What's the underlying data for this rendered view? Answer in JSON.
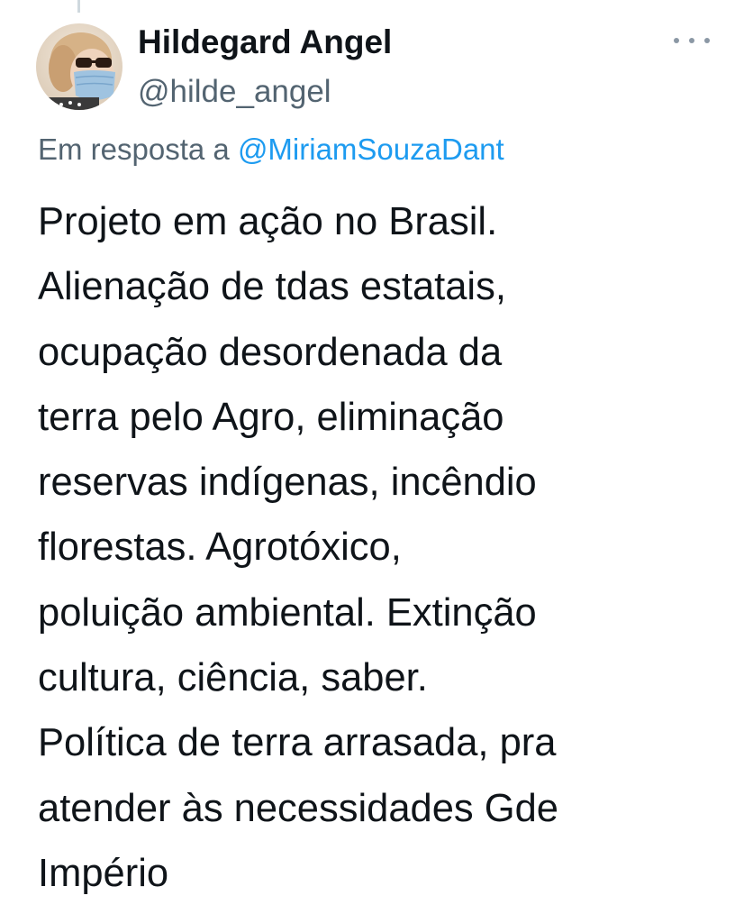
{
  "tweet": {
    "author": {
      "display_name": "Hildegard Angel",
      "handle": "@hilde_angel",
      "avatar_icon": "profile-photo-icon"
    },
    "more_icon": "more-options-icon",
    "reply": {
      "prefix": "Em resposta a",
      "mention": "@MiriamSouzaDant"
    },
    "text_lines": [
      "Projeto em ação no Brasil.",
      "Alienação de tdas estatais,",
      "ocupação desordenada da",
      "terra pelo Agro, eliminação",
      "reservas indígenas, incêndio",
      "florestas. Agrotóxico,",
      "poluição ambiental. Extinção",
      "cultura, ciência, saber.",
      "Política de terra arrasada, pra",
      "atender às necessidades Gde",
      "Império"
    ]
  },
  "colors": {
    "text_primary": "#0f1419",
    "text_secondary": "#536471",
    "accent": "#1d9bf0",
    "background": "#ffffff"
  }
}
